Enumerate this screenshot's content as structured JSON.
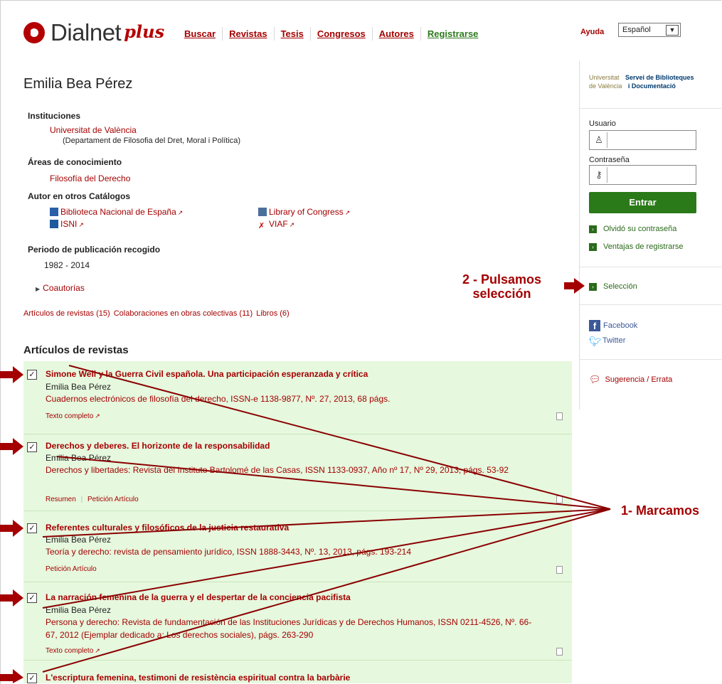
{
  "header": {
    "logo_text": "Dialnet",
    "logo_plus": "plus",
    "nav": [
      "Buscar",
      "Revistas",
      "Tesis",
      "Congresos",
      "Autores",
      "Registrarse"
    ],
    "help": "Ayuda",
    "language": "Español"
  },
  "author": {
    "name": "Emilia Bea Pérez",
    "institutions_label": "Instituciones",
    "institution": "Universitat de València",
    "department": "(Departament de Filosofia del Dret, Moral i Política)",
    "areas_label": "Áreas de conocimiento",
    "area": "Filosofía del Derecho",
    "catalogs_label": "Autor en otros Catálogos",
    "catalogs": [
      "Biblioteca Nacional de España",
      "Library of Congress",
      "ISNI",
      "VIAF"
    ],
    "period_label": "Periodo de publicación recogido",
    "period": "1982 - 2014",
    "coauthors": "Coautorías"
  },
  "counts": {
    "articles": "Artículos de revistas (15)",
    "collabs": "Colaboraciones en obras colectivas (11)",
    "books": "Libros (6)"
  },
  "list": {
    "heading": "Artículos de revistas",
    "items": [
      {
        "title": "Simone Weil y la Guerra Civil española. Una participación esperanzada y crítica",
        "author": "Emilia Bea Pérez",
        "source": "Cuadernos electrónicos de filosofía del derecho, ISSN-e 1138-9877, Nº. 27, 2013, 68 págs.",
        "links": [
          "Texto completo"
        ]
      },
      {
        "title": "Derechos y deberes. El horizonte de la responsabilidad",
        "author": "Emilia Bea Pérez",
        "source": "Derechos y libertades: Revista del Instituto Bartolomé de las Casas, ISSN 1133-0937, Año nº 17, Nº 29, 2013, págs. 53-92",
        "links": [
          "Resumen",
          "Petición Artículo"
        ]
      },
      {
        "title": "Referentes culturales y filosóficos de la justicia restaurativa",
        "author": "Emilia Bea Pérez",
        "source": "Teoría y derecho: revista de pensamiento jurídico, ISSN 1888-3443, Nº. 13, 2013, págs. 193-214",
        "links": [
          "Petición Artículo"
        ]
      },
      {
        "title": "La narración femenina de la guerra y el despertar de la conciencia pacifista",
        "author": "Emilia Bea Pérez",
        "source": "Persona y derecho: Revista de fundamentación de las Instituciones Jurídicas y de Derechos Humanos, ISSN 0211-4526, Nº. 66-67, 2012 (Ejemplar dedicado a: Los derechos sociales), págs. 263-290",
        "links": [
          "Texto completo"
        ]
      },
      {
        "title": "L'escriptura femenina, testimoni de resistència espiritual contra la barbàrie",
        "author": "",
        "source": "",
        "links": []
      }
    ]
  },
  "sidebar": {
    "university_line1": "Universitat",
    "university_line2": "de València",
    "library_line1": "Servei de Biblioteques",
    "library_line2": "i Documentació",
    "user_label": "Usuario",
    "password_label": "Contraseña",
    "login_button": "Entrar",
    "forgot": "Olvidó su contraseña",
    "benefits": "Ventajas de registrarse",
    "selection": "Selección",
    "facebook": "Facebook",
    "twitter": "Twitter",
    "suggestion": "Sugerencia / Errata"
  },
  "annotations": {
    "step2_line1": "2 - Pulsamos",
    "step2_line2": "selección",
    "step1": "1- Marcamos"
  },
  "colors": {
    "brand": "#a40000",
    "green": "#2a7a1a",
    "list_bg": "#e6f8de"
  }
}
